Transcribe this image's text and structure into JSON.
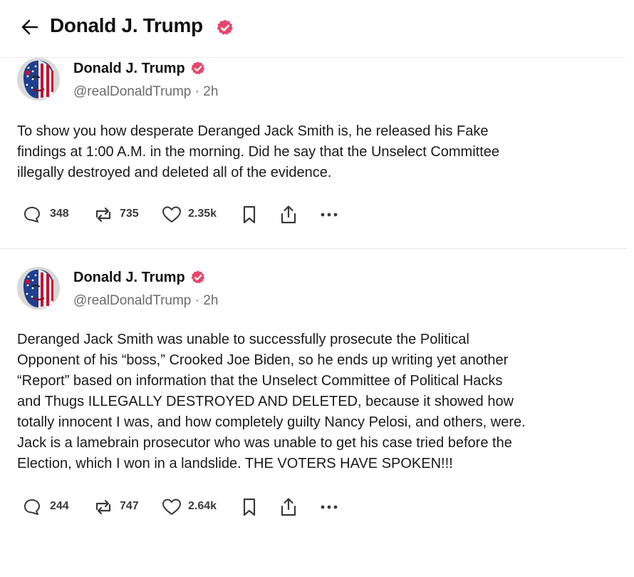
{
  "header": {
    "title": "Donald J. Trump",
    "verified_color": "#e5476b"
  },
  "posts": [
    {
      "author_name": "Donald J. Trump",
      "handle_time": "@realDonaldTrump · 2h",
      "lines": [
        "To show you how desperate Deranged Jack Smith is, he released his Fake",
        "findings at 1:00 A.M. in the morning. Did he say that the Unselect Committee",
        "illegally destroyed and deleted all of the evidence."
      ],
      "replies": "348",
      "reposts": "735",
      "likes": "2.35k"
    },
    {
      "author_name": "Donald J. Trump",
      "handle_time": "@realDonaldTrump · 2h",
      "lines": [
        "Deranged Jack Smith was unable to successfully prosecute the Political",
        "Opponent of his “boss,” Crooked Joe Biden, so he ends up writing yet another",
        "“Report” based on information that the Unselect Committee of Political Hacks",
        "and Thugs ILLEGALLY DESTROYED AND DELETED, because it showed how",
        "totally innocent I was, and how completely guilty Nancy Pelosi, and others, were.",
        "Jack is a lamebrain prosecutor who was unable to get his case tried before the",
        "Election, which I won in a landslide. THE VOTERS HAVE SPOKEN!!!"
      ],
      "replies": "244",
      "reposts": "747",
      "likes": "2.64k"
    }
  ],
  "icons": {
    "back": "arrow-left-icon",
    "verified": "verified-badge-icon",
    "reply": "reply-bubble-icon",
    "repost": "repost-icon",
    "like": "heart-icon",
    "bookmark": "bookmark-icon",
    "share": "share-icon",
    "more": "more-dots-icon"
  }
}
